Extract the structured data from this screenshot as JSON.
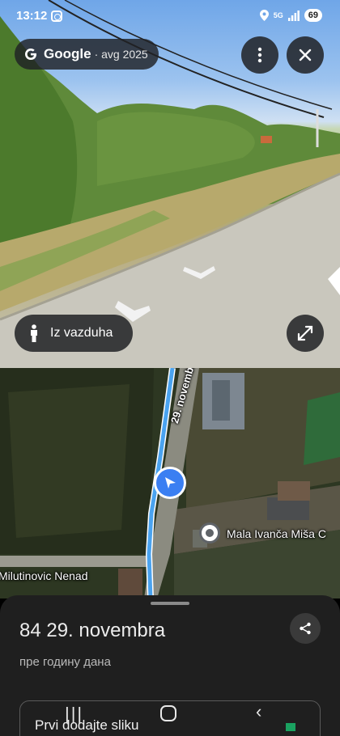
{
  "status_bar": {
    "time": "13:12",
    "network": "5G",
    "battery": "69"
  },
  "street_view": {
    "brand": "Google",
    "date": "· avg 2025",
    "aerial_label": "Iz vazduha"
  },
  "map": {
    "street_label": "29. novembra",
    "place_label": "Mala Ivanča Miša C",
    "person_label": "Milutinovic Nenad"
  },
  "sheet": {
    "title": "84 29. novembra",
    "subtitle": "пре годину дана",
    "add_photo_label": "Prvi dodajte sliku"
  },
  "colors": {
    "route": "#4aa3f0",
    "pointer": "#3b7ff2",
    "sheet_bg": "#1f1f1f"
  },
  "icons": [
    "instagram-icon",
    "location-icon",
    "signal-icon",
    "google-logo-icon",
    "more-vert-icon",
    "close-icon",
    "person-icon",
    "expand-icon",
    "navigation-arrow-icon",
    "place-pin-icon",
    "share-icon",
    "recents-icon",
    "home-icon",
    "back-icon"
  ]
}
